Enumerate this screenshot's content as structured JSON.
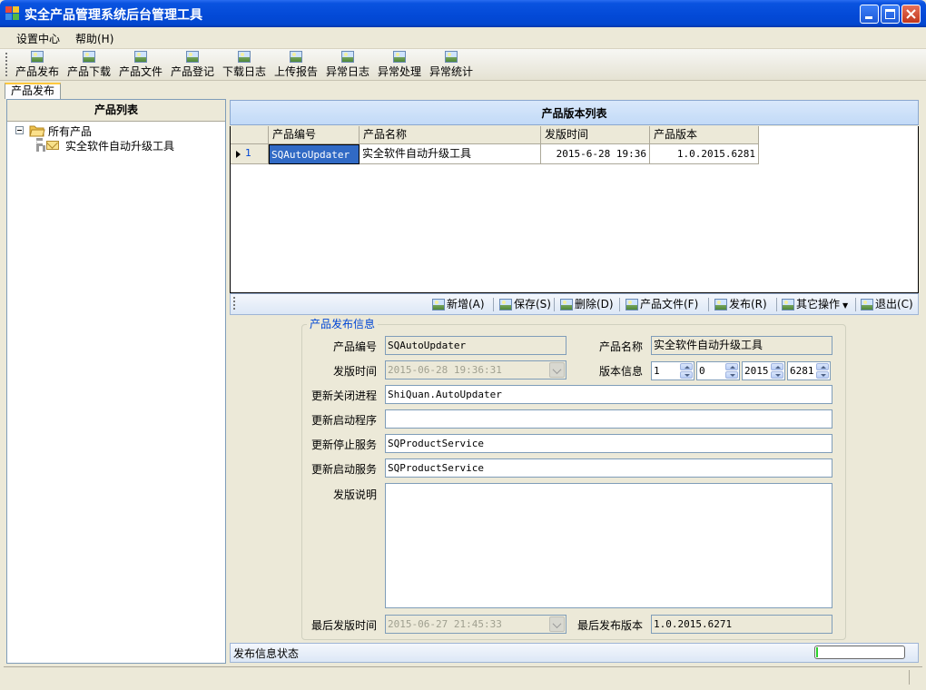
{
  "window": {
    "title": "实全产品管理系统后台管理工具"
  },
  "menu": {
    "items": [
      "设置中心",
      "帮助(H)"
    ]
  },
  "toolbar": {
    "items": [
      "产品发布",
      "产品下载",
      "产品文件",
      "产品登记",
      "下载日志",
      "上传报告",
      "异常日志",
      "异常处理",
      "异常统计"
    ]
  },
  "tabs": {
    "active": "产品发布"
  },
  "left": {
    "header": "产品列表",
    "tree": {
      "root": "所有产品",
      "child": "实全软件自动升级工具"
    }
  },
  "grid": {
    "header": "产品版本列表",
    "columns": [
      "产品编号",
      "产品名称",
      "发版时间",
      "产品版本"
    ],
    "rows": [
      {
        "index": "1",
        "code": "SQAutoUpdater",
        "name": "实全软件自动升级工具",
        "time": "2015-6-28 19:36",
        "version": "1.0.2015.6281"
      }
    ]
  },
  "actions": {
    "add": "新增(A)",
    "save": "保存(S)",
    "delete": "删除(D)",
    "files": "产品文件(F)",
    "publish": "发布(R)",
    "other": "其它操作",
    "exit": "退出(C)"
  },
  "form": {
    "group_title": "产品发布信息",
    "code_label": "产品编号",
    "code": "SQAutoUpdater",
    "name_label": "产品名称",
    "name": "实全软件自动升级工具",
    "date_label": "发版时间",
    "date": "2015-06-28 19:36:31",
    "version_label": "版本信息",
    "v1": "1",
    "v2": "0",
    "v3": "2015",
    "v4": "6281",
    "close_label": "更新关闭进程",
    "close_process": "ShiQuan.AutoUpdater",
    "start_label": "更新启动程序",
    "start_program": "",
    "stop_svc_label": "更新停止服务",
    "stop_service": "SQProductService",
    "start_svc_label": "更新启动服务",
    "start_service": "SQProductService",
    "notes_label": "发版说明",
    "notes": "",
    "last_date_label": "最后发版时间",
    "last_date": "2015-06-27 21:45:33",
    "last_version_label": "最后发布版本",
    "last_version": "1.0.2015.6271"
  },
  "status": {
    "text": "发布信息状态",
    "progress": 0.02
  }
}
